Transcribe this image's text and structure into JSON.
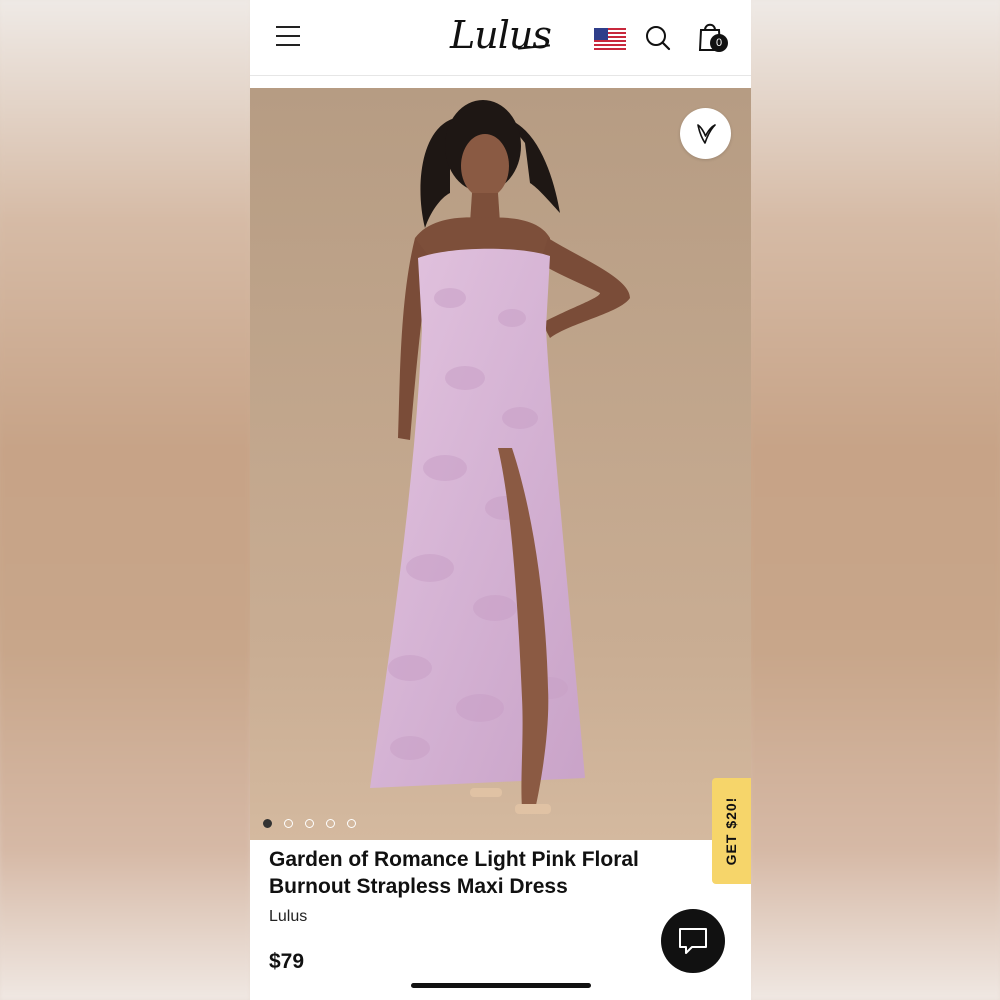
{
  "app": {
    "brand_logo": "Lulus",
    "cart_count": "0",
    "region_flag": "us-flag-icon"
  },
  "product": {
    "title": "Garden of Romance Light Pink Floral Burnout Strapless Maxi Dress",
    "brand": "Lulus",
    "price": "$79",
    "image_count": 5,
    "active_image_index": 0
  },
  "promo": {
    "tab_label": "GET $20!"
  },
  "icons": {
    "menu": "hamburger-menu-icon",
    "search": "search-icon",
    "cart": "shopping-bag-icon",
    "favorite": "heart-icon",
    "chat": "chat-bubble-icon"
  },
  "colors": {
    "promo_tab": "#f6d56a",
    "dress": "#d8b6d6",
    "background_studio": "#c3a78c"
  }
}
